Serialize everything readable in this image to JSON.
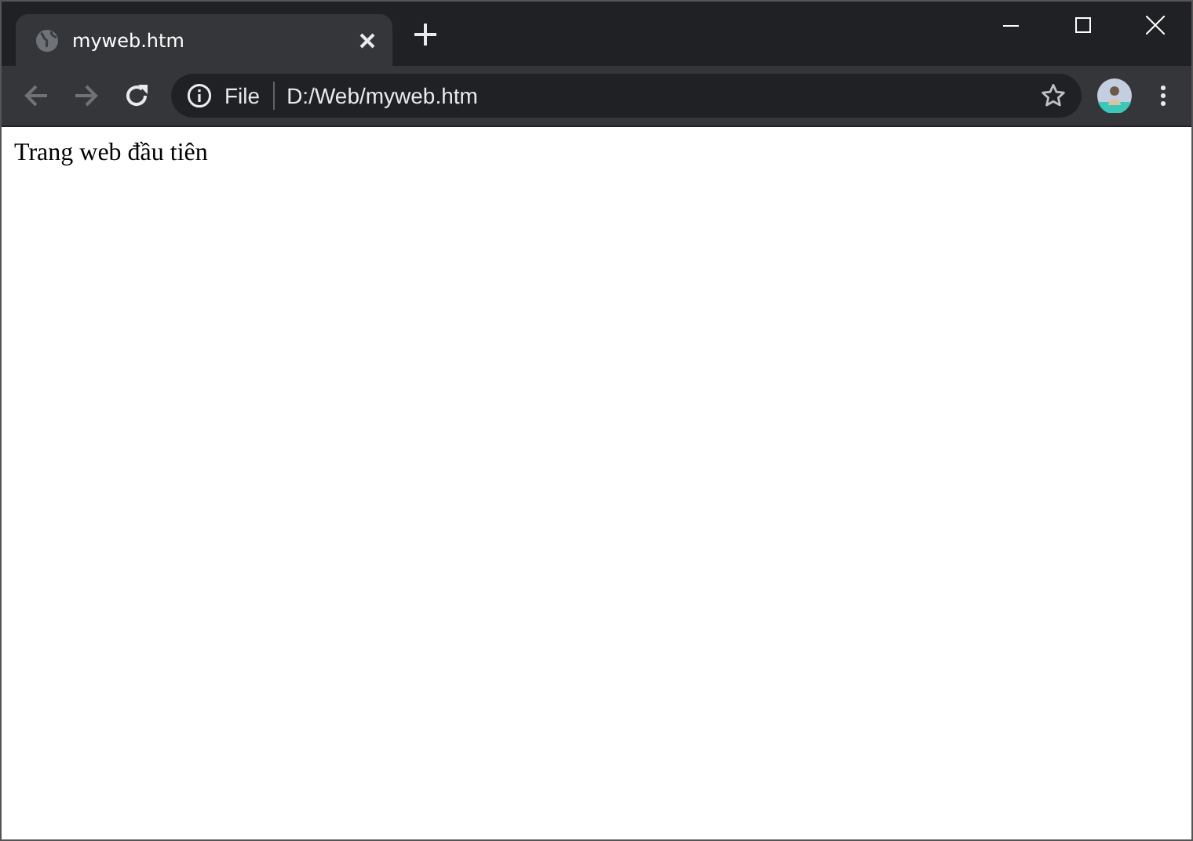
{
  "tabs": [
    {
      "title": "myweb.htm",
      "selected": true
    }
  ],
  "address_bar": {
    "scheme": "File",
    "url": "D:/Web/myweb.htm"
  },
  "toolbar": {
    "back_disabled": true,
    "forward_disabled": true
  },
  "page": {
    "text": "Trang web đầu tiên"
  }
}
